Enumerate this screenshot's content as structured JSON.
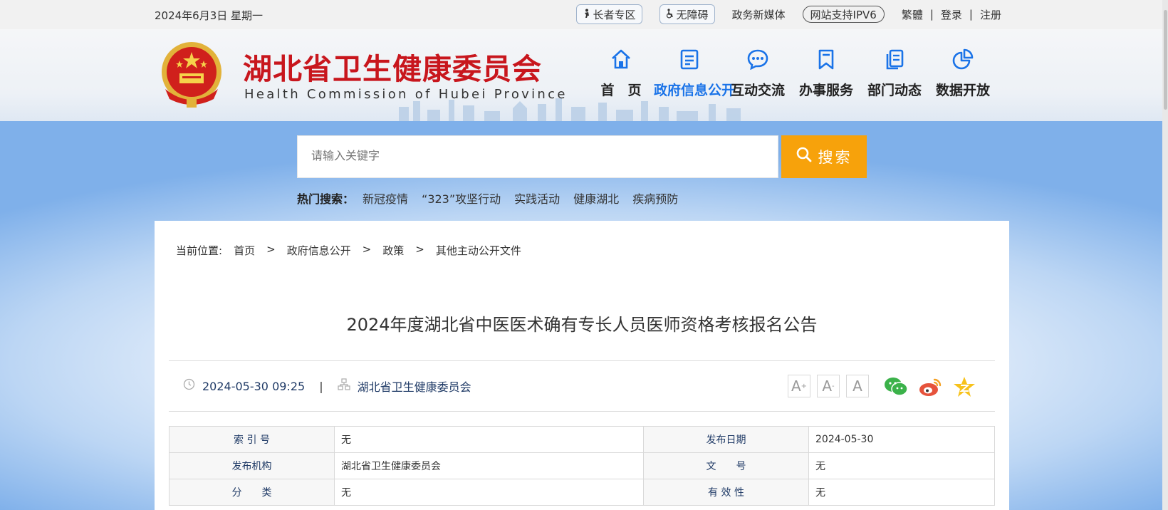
{
  "topbar": {
    "date": "2024年6月3日 星期一",
    "elder": "长者专区",
    "accessible": "无障碍",
    "media": "政务新媒体",
    "ipv6": "网站支持IPV6",
    "trad": "繁體",
    "login": "登录",
    "register": "注册",
    "sep": "|"
  },
  "header": {
    "title_cn": "湖北省卫生健康委员会",
    "title_en": "Health Commission of Hubei Province",
    "nav": [
      {
        "label": "首　页",
        "icon": "home-icon"
      },
      {
        "label": "政府信息公开",
        "icon": "document-list-icon",
        "active": true
      },
      {
        "label": "互动交流",
        "icon": "chat-bubble-icon"
      },
      {
        "label": "办事服务",
        "icon": "bookmark-icon"
      },
      {
        "label": "部门动态",
        "icon": "copy-document-icon"
      },
      {
        "label": "数据开放",
        "icon": "pie-chart-icon"
      }
    ],
    "colors": {
      "brand_red": "#c8161d",
      "active_blue": "#1a73e8"
    }
  },
  "search": {
    "placeholder": "请输入关键字",
    "button": "搜索",
    "hot_label": "热门搜索：",
    "hot_items": [
      "新冠疫情",
      "“323”攻坚行动",
      "实践活动",
      "健康湖北",
      "疾病预防"
    ],
    "button_color": "#f7a20b"
  },
  "breadcrumb": {
    "prefix": "当前位置:",
    "items": [
      "首页",
      "政府信息公开",
      "政策",
      "其他主动公开文件"
    ],
    "sep": ">"
  },
  "article": {
    "title": "2024年度湖北省中医医术确有专长人员医师资格考核报名公告",
    "datetime": "2024-05-30 09:25",
    "source": "湖北省卫生健康委员会",
    "bar": "|",
    "font_buttons": [
      "A",
      "A",
      "A"
    ],
    "font_sup": [
      "+",
      "-"
    ]
  },
  "info_table": {
    "rows": [
      [
        {
          "k": "索 引 号",
          "v": "无"
        },
        {
          "k": "发布日期",
          "v": "2024-05-30"
        }
      ],
      [
        {
          "k": "发布机构",
          "v": "湖北省卫生健康委员会"
        },
        {
          "k": "文　　号",
          "v": "无"
        }
      ],
      [
        {
          "k": "分　　类",
          "v": "无"
        },
        {
          "k": "有 效 性",
          "v": "无"
        }
      ]
    ]
  }
}
